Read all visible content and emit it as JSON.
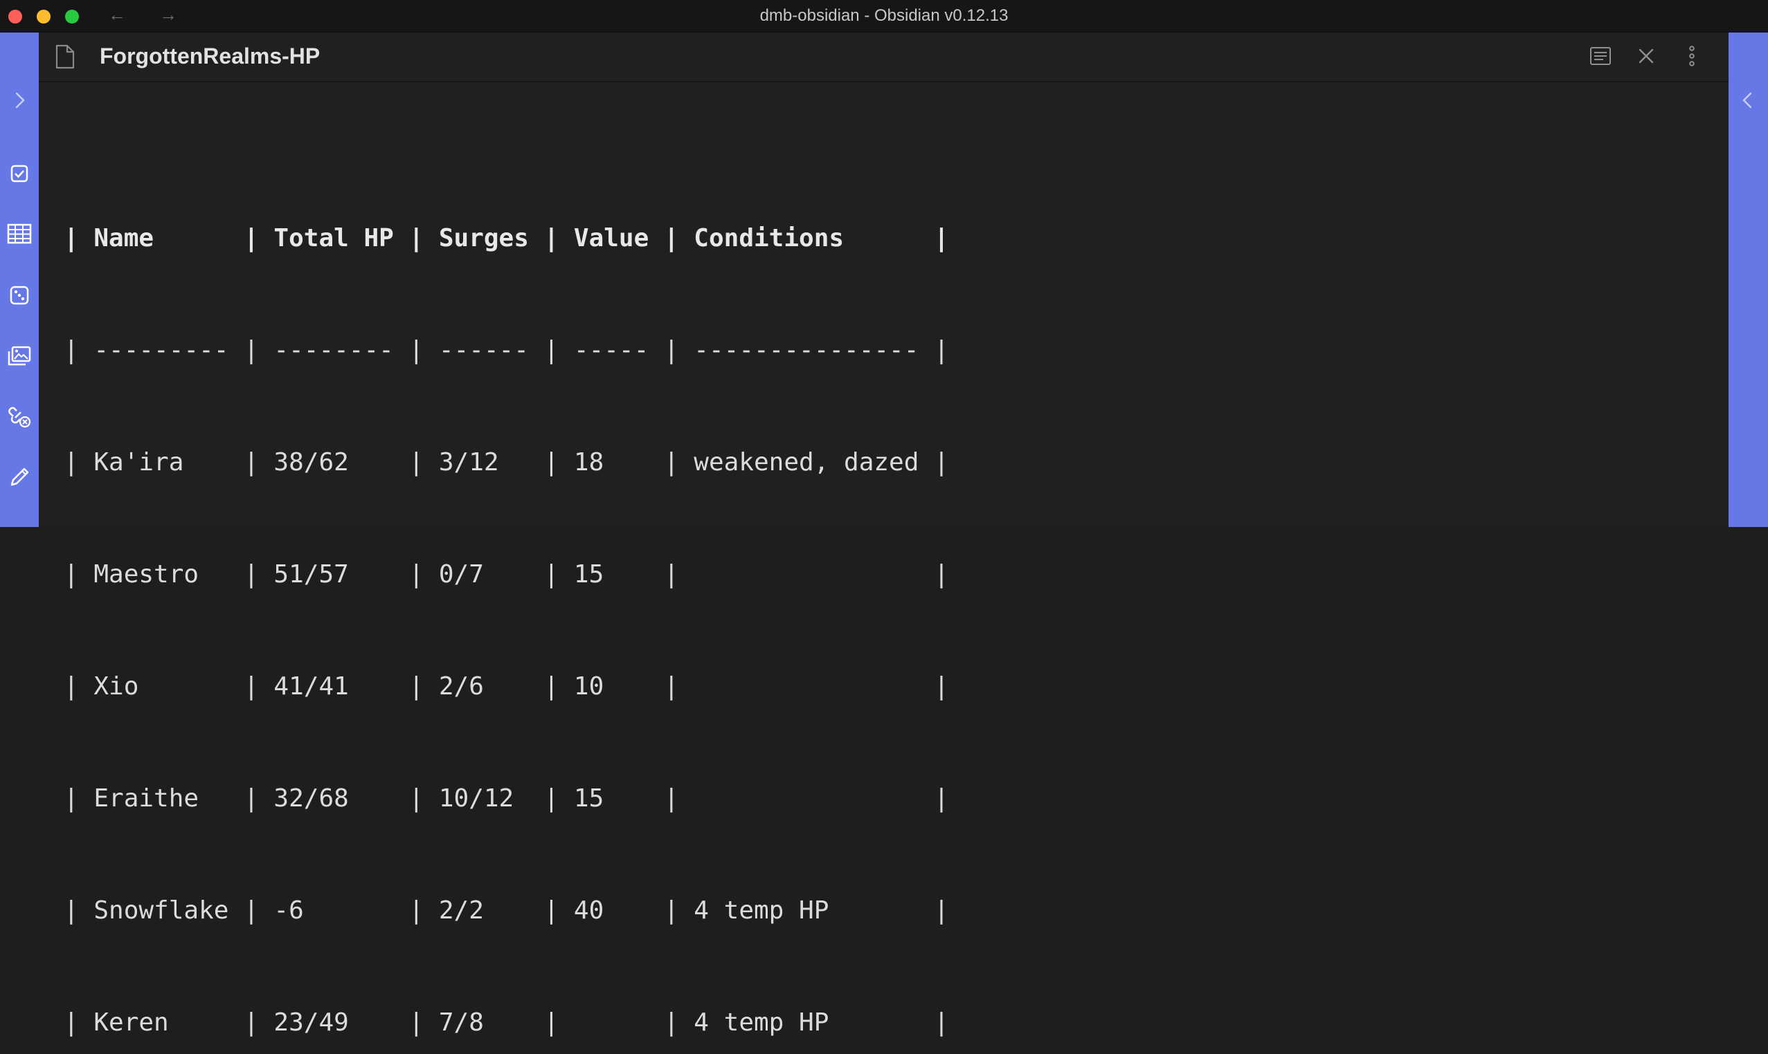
{
  "window": {
    "title": "dmb-obsidian - Obsidian v0.12.13",
    "back_icon": "arrow-left-icon",
    "forward_icon": "arrow-right-icon"
  },
  "left_ribbon": {
    "items": [
      "chevron-right-icon",
      "checkbox-icon",
      "table-icon",
      "dice-icon",
      "image-gallery-icon",
      "link-broken-icon",
      "pencil-icon"
    ]
  },
  "right_ribbon": {
    "items": [
      "chevron-left-icon"
    ]
  },
  "pane": {
    "title": "ForgottenRealms-HP",
    "actions": [
      "reading-view-icon",
      "close-icon",
      "more-options-icon"
    ]
  },
  "editor": {
    "lines": [
      "| Name      | Total HP | Surges | Value | Conditions      |",
      "| --------- | -------- | ------ | ----- | --------------- |",
      "| Ka'ira    | 38/62    | 3/12   | 18    | weakened, dazed |",
      "| Maestro   | 51/57    | 0/7    | 15    |                 |",
      "| Xio       | 41/41    | 2/6    | 10    |                 |",
      "| Eraithe   | 32/68    | 10/12  | 15    |                 |",
      "| Snowflake | -6       | 2/2    | 40    | 4 temp HP       |",
      "| Keren     | 23/49    | 7/8    |       | 4 temp HP       |"
    ]
  },
  "colors": {
    "ribbon": "#6677e6",
    "background": "#202020",
    "text": "#dcdcdc"
  }
}
